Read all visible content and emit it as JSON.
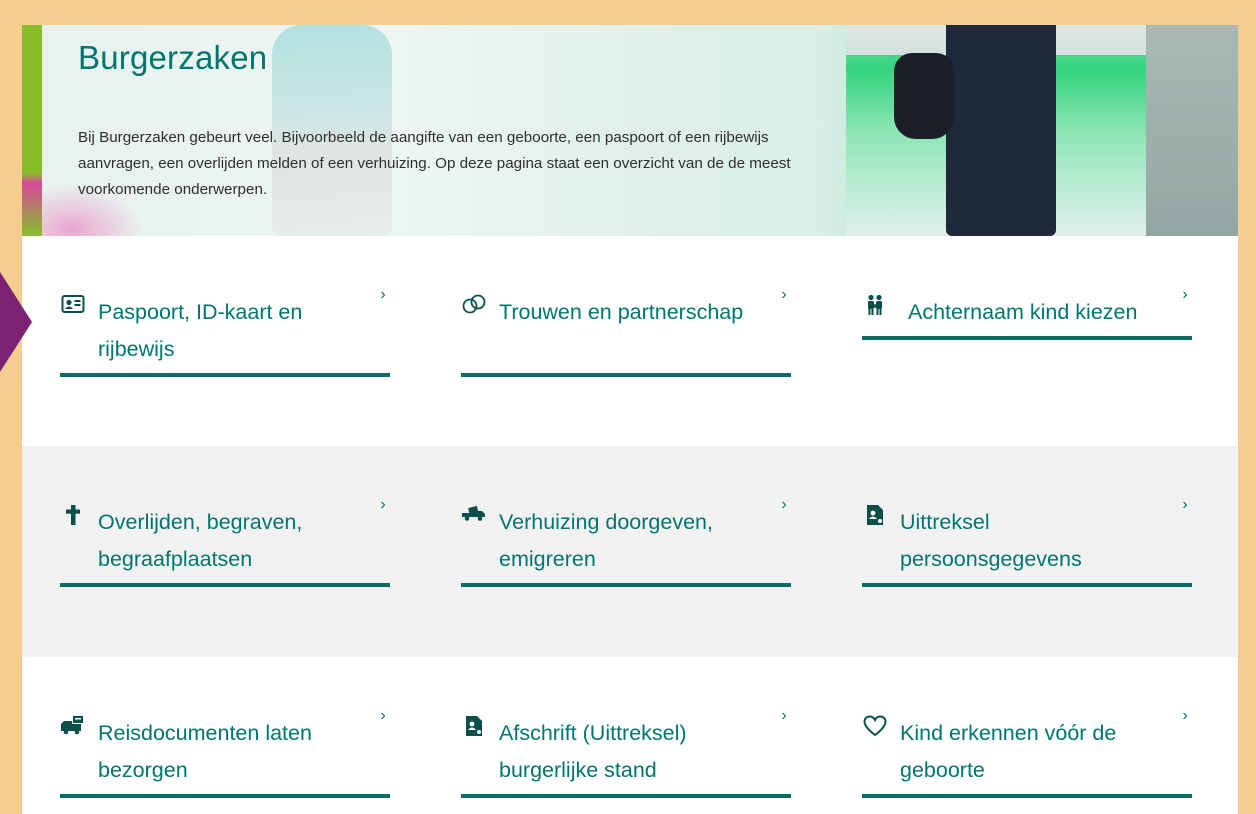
{
  "hero": {
    "title": "Burgerzaken",
    "text": "Bij Burgerzaken gebeurt veel. Bijvoorbeeld de aangifte van een geboorte, een paspoort of een rijbewijs aanvragen, een overlijden melden of een verhuizing. Op deze pagina staat een overzicht van de de meest voorkomende onderwerpen."
  },
  "tiles": [
    {
      "label": "Paspoort, ID-kaart en rijbewijs",
      "icon": "id-card-icon",
      "chevron": "›"
    },
    {
      "label": "Trouwen en partnerschap",
      "icon": "rings-icon",
      "chevron": "›"
    },
    {
      "label": "Achternaam kind kiezen",
      "icon": "family-icon",
      "chevron": "›"
    },
    {
      "label": "Overlijden, begraven, begraafplaatsen",
      "icon": "cross-icon",
      "chevron": "›"
    },
    {
      "label": "Verhuizing doorgeven, emigreren",
      "icon": "moving-truck-icon",
      "chevron": "›"
    },
    {
      "label": "Uittreksel persoonsgegevens",
      "icon": "document-person-icon",
      "chevron": "›"
    },
    {
      "label": "Reisdocumenten laten bezorgen",
      "icon": "delivery-van-icon",
      "chevron": "›"
    },
    {
      "label": "Afschrift (Uittreksel) burgerlijke stand",
      "icon": "document-person-icon",
      "chevron": "›"
    },
    {
      "label": "Kind erkennen vóór de geboorte",
      "icon": "heart-icon",
      "chevron": "›"
    }
  ],
  "colors": {
    "frame": "#f5cd8e",
    "accent": "#00766e",
    "underline": "#0a6d64",
    "hero_bar": "#86be2a",
    "side_arrow": "#7b2274"
  }
}
